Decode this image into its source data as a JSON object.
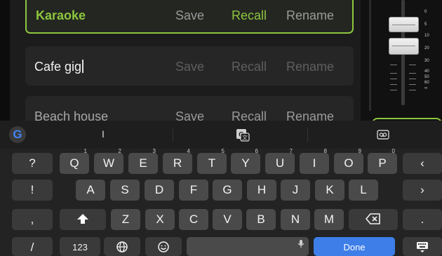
{
  "scenes": [
    {
      "name": "Karaoke",
      "save": "Save",
      "recall": "Recall",
      "rename": "Rename",
      "selected": true
    },
    {
      "name": "Cafe gig",
      "save": "Save",
      "recall": "Recall",
      "rename": "Rename",
      "editing": true
    },
    {
      "name": "Beach house",
      "save": "Save",
      "recall": "Recall",
      "rename": "Rename"
    }
  ],
  "fader": {
    "scale": [
      "0",
      "5",
      "10",
      "20",
      "30",
      "40",
      "50",
      "60",
      "∞"
    ]
  },
  "keyboard": {
    "suggestion": "I",
    "row1": [
      {
        "label": "Q",
        "hint": "1"
      },
      {
        "label": "W",
        "hint": "2"
      },
      {
        "label": "E",
        "hint": "3"
      },
      {
        "label": "R",
        "hint": "4"
      },
      {
        "label": "T",
        "hint": "5"
      },
      {
        "label": "Y",
        "hint": "6"
      },
      {
        "label": "U",
        "hint": "7"
      },
      {
        "label": "I",
        "hint": "8"
      },
      {
        "label": "O",
        "hint": "9"
      },
      {
        "label": "P",
        "hint": "0"
      }
    ],
    "row1_left": "?",
    "row1_right": "‹",
    "row2": [
      "A",
      "S",
      "D",
      "F",
      "G",
      "H",
      "J",
      "K",
      "L"
    ],
    "row2_left": "!",
    "row2_right": "›",
    "row3": [
      "Z",
      "X",
      "C",
      "V",
      "B",
      "N",
      "M"
    ],
    "row3_left": ",",
    "row3_right": ".",
    "row4_left": "/",
    "num_key": "123",
    "done_key": "Done",
    "colors": {
      "accent": "#8cc63e",
      "done": "#3d7ee8"
    }
  }
}
